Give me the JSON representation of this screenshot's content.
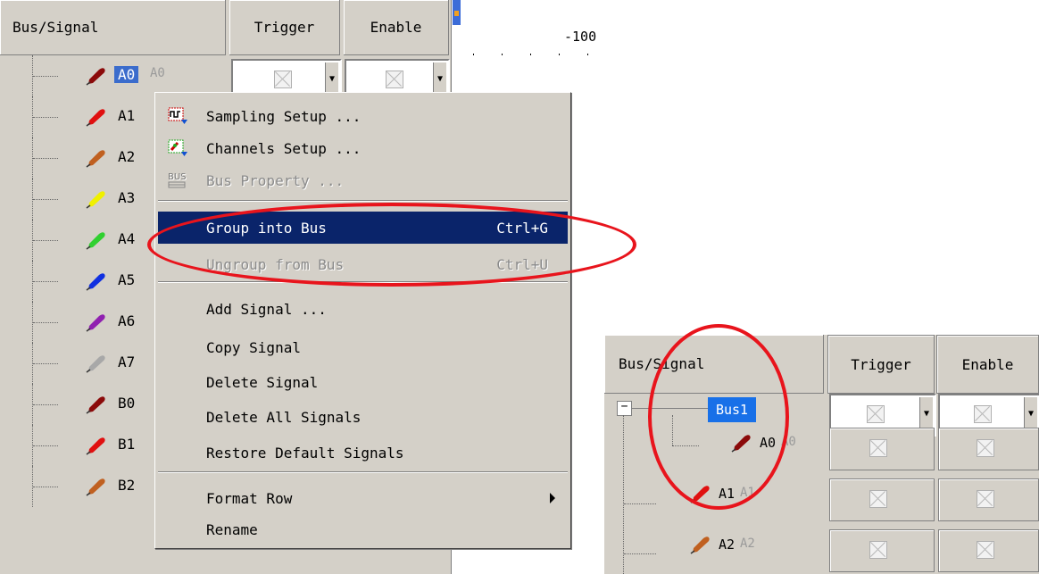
{
  "left_panel": {
    "header": {
      "signal": "Bus/Signal",
      "trigger": "Trigger",
      "enable": "Enable"
    },
    "timeline_label": "-100",
    "signals": [
      {
        "label": "A0",
        "ghost": "A0",
        "color": "#8b0a0a",
        "selected": true
      },
      {
        "label": "A1",
        "color": "#e01010"
      },
      {
        "label": "A2",
        "color": "#c06020"
      },
      {
        "label": "A3",
        "color": "#f0f000"
      },
      {
        "label": "A4",
        "color": "#30d030"
      },
      {
        "label": "A5",
        "color": "#1030e0"
      },
      {
        "label": "A6",
        "color": "#9020b0"
      },
      {
        "label": "A7",
        "color": "#a8a8a8"
      },
      {
        "label": "B0",
        "color": "#8b0a0a"
      },
      {
        "label": "B1",
        "color": "#e01010"
      },
      {
        "label": "B2",
        "color": "#c06020"
      }
    ]
  },
  "context_menu": {
    "items": [
      {
        "label": "Sampling Setup ...",
        "icon": "sampling-icon"
      },
      {
        "label": "Channels Setup ...",
        "icon": "channels-icon"
      },
      {
        "label": "Bus Property ...",
        "icon": "bus-property-icon",
        "disabled": true
      },
      {
        "label": "Group into Bus",
        "shortcut": "Ctrl+G",
        "highlighted": true
      },
      {
        "label": "Ungroup from Bus",
        "shortcut": "Ctrl+U",
        "disabled": true
      },
      {
        "label": "Add Signal ..."
      },
      {
        "label": "Copy Signal"
      },
      {
        "label": "Delete Signal"
      },
      {
        "label": "Delete All Signals"
      },
      {
        "label": "Restore Default Signals"
      },
      {
        "label": "Format Row",
        "submenu": true
      },
      {
        "label": "Rename"
      }
    ]
  },
  "right_panel": {
    "header": {
      "signal": "Bus/Signal",
      "trigger": "Trigger",
      "enable": "Enable"
    },
    "bus": {
      "label": "Bus1",
      "expander": "−"
    },
    "signals": [
      {
        "label": "A0",
        "ghost": "A0",
        "color": "#8b0a0a"
      },
      {
        "label": "A1",
        "ghost": "A1",
        "color": "#e01010"
      },
      {
        "label": "A2",
        "ghost": "A2",
        "color": "#c06020"
      }
    ]
  },
  "colors": {
    "highlight": "#0a246a",
    "selection": "#3b6ccc",
    "annotation": "#e8141c",
    "panel": "#d4d0c8"
  }
}
